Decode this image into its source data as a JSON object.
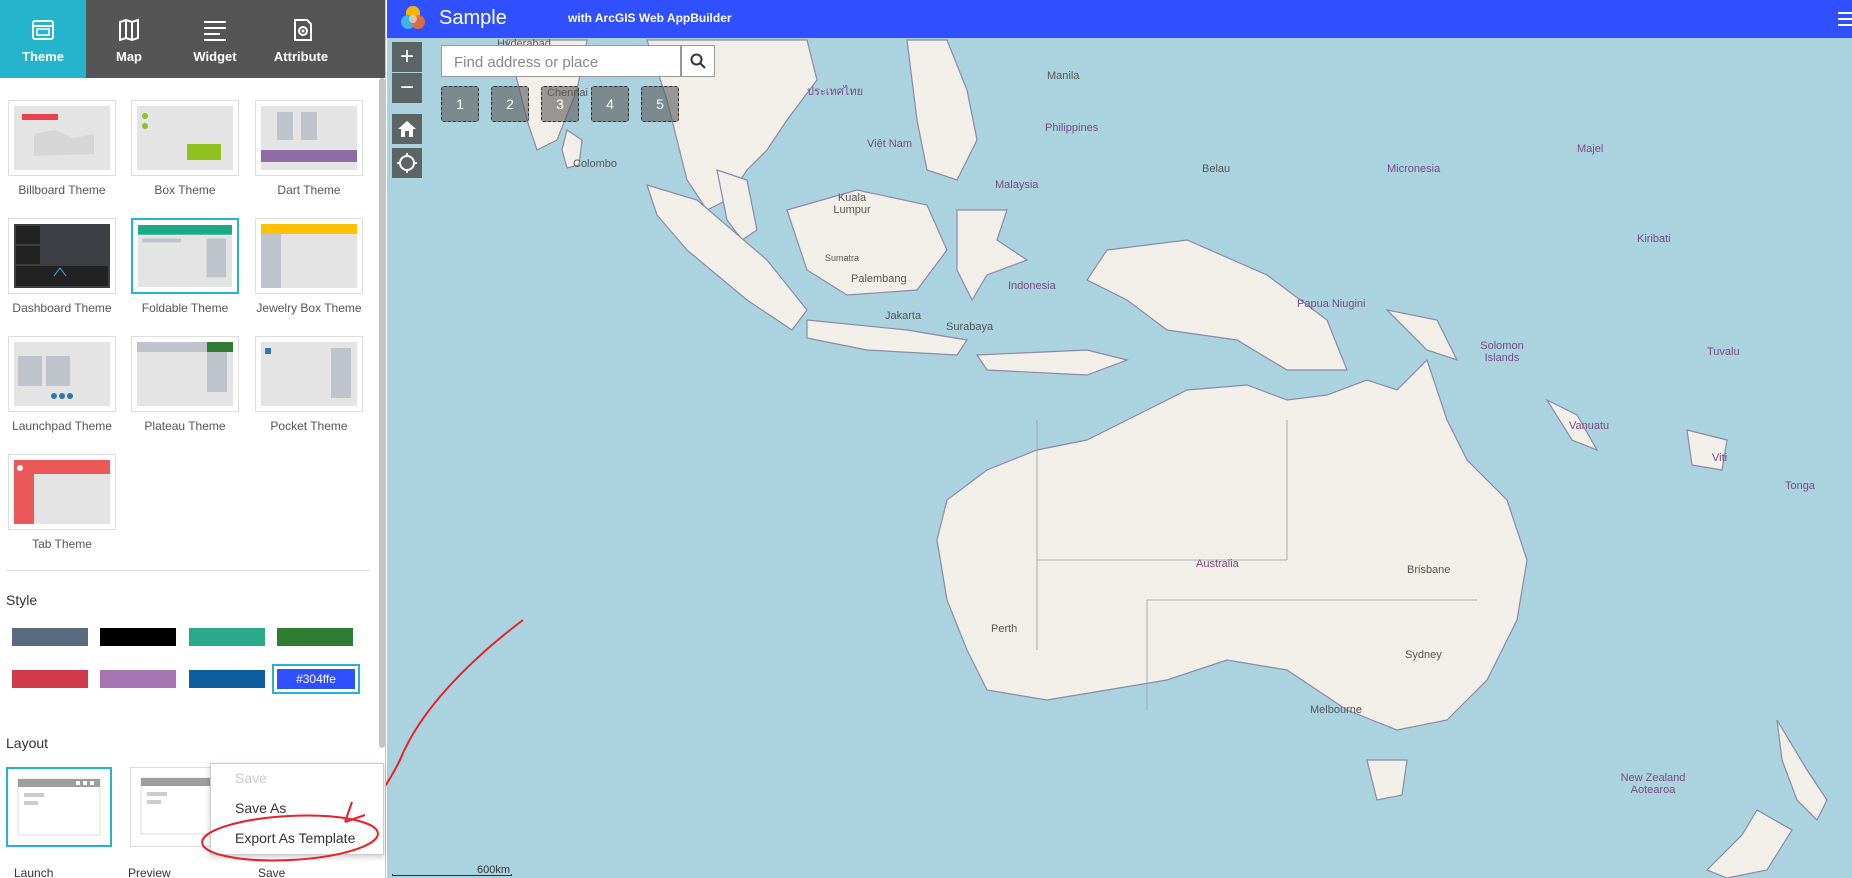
{
  "tabs": [
    {
      "label": "Theme",
      "icon": "theme-icon"
    },
    {
      "label": "Map",
      "icon": "map-icon"
    },
    {
      "label": "Widget",
      "icon": "widget-icon"
    },
    {
      "label": "Attribute",
      "icon": "attribute-icon"
    }
  ],
  "themes": [
    {
      "label": "Billboard Theme"
    },
    {
      "label": "Box Theme"
    },
    {
      "label": "Dart Theme"
    },
    {
      "label": "Dashboard Theme"
    },
    {
      "label": "Foldable Theme"
    },
    {
      "label": "Jewelry Box Theme"
    },
    {
      "label": "Launchpad Theme"
    },
    {
      "label": "Plateau Theme"
    },
    {
      "label": "Pocket Theme"
    },
    {
      "label": "Tab Theme"
    }
  ],
  "selected_theme": "Foldable Theme",
  "style": {
    "title": "Style",
    "colors": [
      "#5a6a80",
      "#000000",
      "#2aaa8a",
      "#2e7d32",
      "#d13a4a",
      "#a674b0",
      "#0f5ea0",
      "#304ffe"
    ],
    "selected_label": "#304ffe"
  },
  "layout": {
    "title": "Layout"
  },
  "context_menu": {
    "items": [
      "Save",
      "Save As",
      "Export As Template"
    ]
  },
  "bottom_bar": [
    "Launch",
    "Preview",
    "Save"
  ],
  "app": {
    "title": "Sample",
    "subtitle": "with ArcGIS Web AppBuilder"
  },
  "search": {
    "placeholder": "Find address or place"
  },
  "bookmarks": [
    "1",
    "2",
    "3",
    "4",
    "5"
  ],
  "map_labels": [
    "Hyderabad",
    "Chennai",
    "ประเทศไทย",
    "Manila",
    "Philippines",
    "Việt Nam",
    "Colombo",
    "Malaysia",
    "Kuala Lumpur",
    "Belau",
    "Micronesia",
    "Majel",
    "Sumatra",
    "Palembang",
    "Indonesia",
    "Kiribati",
    "Jakarta",
    "Surabaya",
    "Papua Niugini",
    "Solomon Islands",
    "Tuvalu",
    "Vanuatu",
    "Viti",
    "Tonga",
    "Australia",
    "Brisbane",
    "Perth",
    "Sydney",
    "Melbourne",
    "New Zealand Aotearoa"
  ],
  "scale": "600km"
}
